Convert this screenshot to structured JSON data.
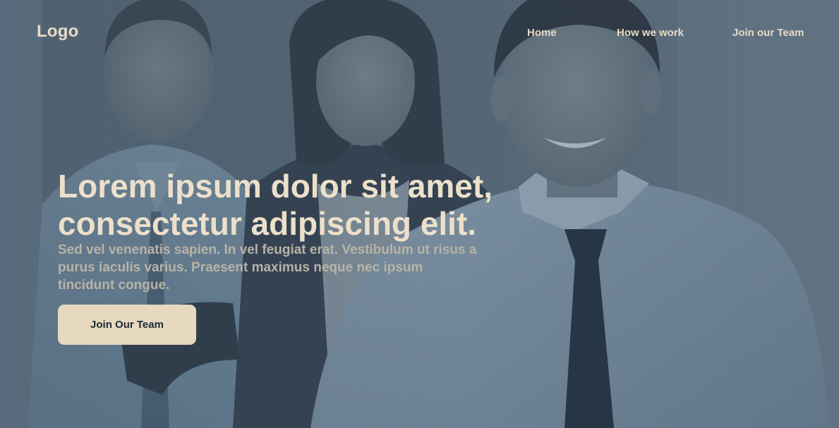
{
  "header": {
    "logo": "Logo",
    "nav": [
      {
        "label": "Home"
      },
      {
        "label": "How we work"
      },
      {
        "label": "Join our Team"
      }
    ]
  },
  "hero": {
    "headline_line1": "Lorem ipsum dolor sit amet,",
    "headline_line2": "consectetur adipiscing elit.",
    "subtext": "Sed vel venenatis sapien. In vel feugiat erat. Vestibulum ut risus a purus iaculis varius. Praesent maximus neque nec ipsum tincidunt congue.",
    "cta_label": "Join Our Team"
  },
  "colors": {
    "overlay": "#4d5e6c",
    "text_primary": "#ece0ca",
    "text_secondary": "#b8b3a6",
    "button_bg": "#e7d9c0",
    "button_text": "#1e2a36"
  }
}
